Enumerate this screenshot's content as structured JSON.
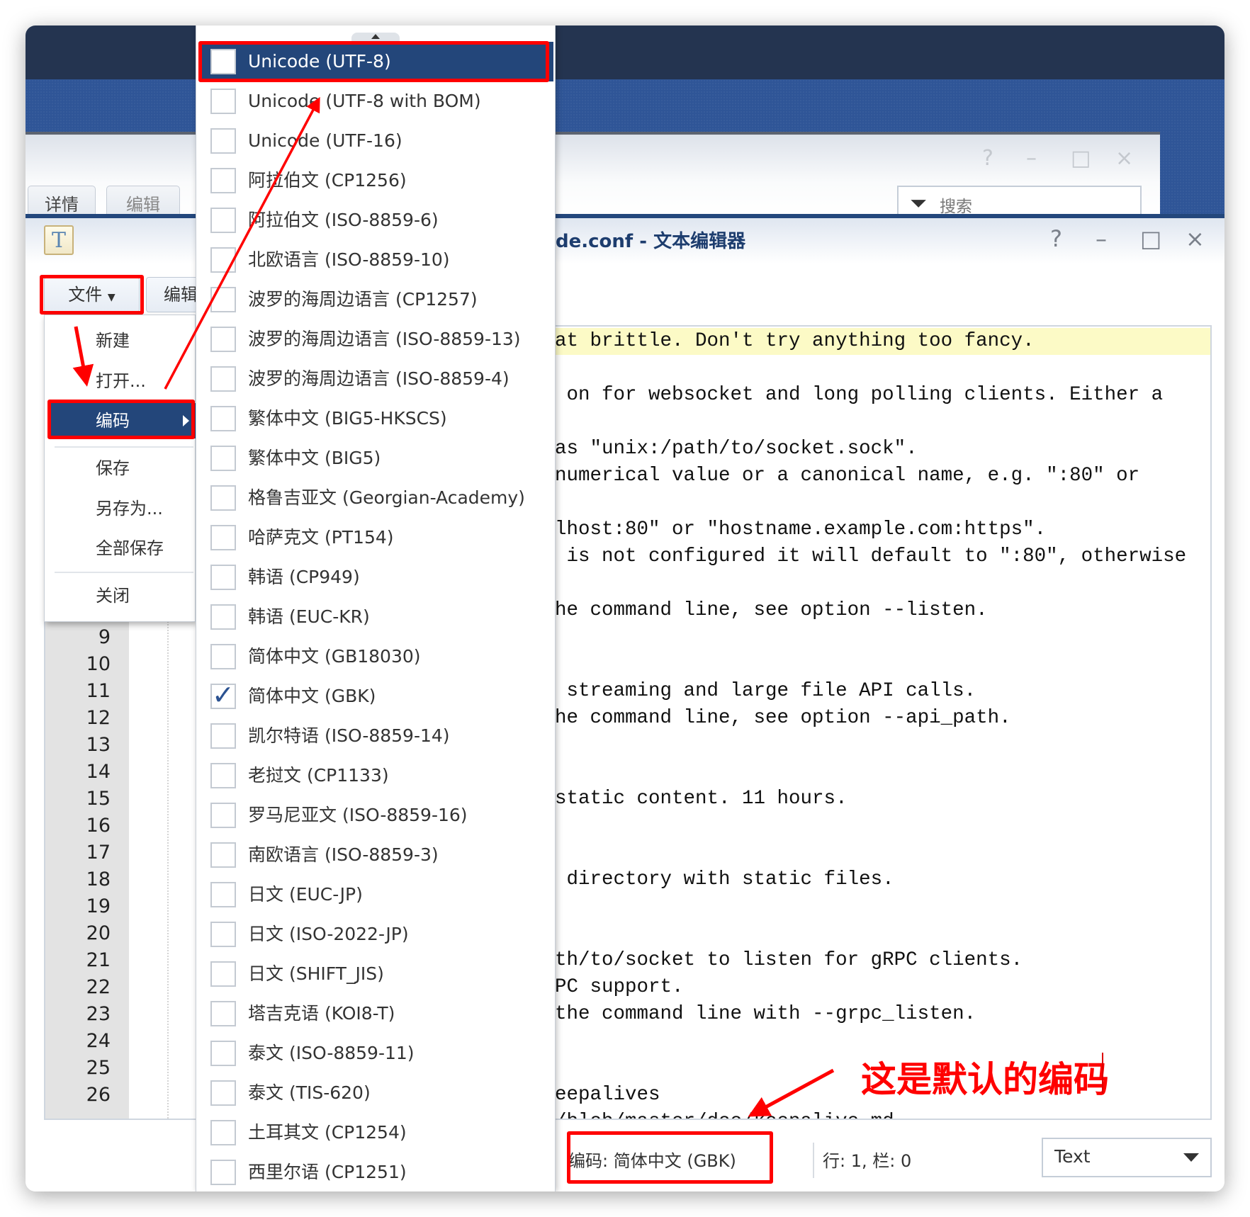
{
  "back_window": {
    "tabs": [
      "详情",
      "编辑"
    ],
    "controls": [
      "?",
      "–",
      "□",
      "×"
    ],
    "search_placeholder": "搜索"
  },
  "editor_window": {
    "title": "de.conf - 文本编辑器",
    "controls": [
      "?",
      "–",
      "□",
      "×"
    ],
    "toolbar": {
      "file_label": "文件",
      "edit_label": "编辑"
    },
    "line_numbers": [
      "9",
      "10",
      "11",
      "12",
      "13",
      "14",
      "15",
      "16",
      "17",
      "18",
      "19",
      "20",
      "21",
      "22",
      "23",
      "24",
      "25",
      "26"
    ],
    "text_rows": [
      {
        "row": 0,
        "text": "at brittle. Don't try anything too fancy.",
        "highlight": true
      },
      {
        "row": 2,
        "text": " on for websocket and long polling clients. Either a"
      },
      {
        "row": 4,
        "text": "as \"unix:/path/to/socket.sock\"."
      },
      {
        "row": 5,
        "text": "numerical value or a canonical name, e.g. \":80\" or"
      },
      {
        "row": 7,
        "text": "lhost:80\" or \"hostname.example.com:https\"."
      },
      {
        "row": 8,
        "text": " is not configured it will default to \":80\", otherwise"
      },
      {
        "row": 10,
        "text": "he command line, see option --listen."
      },
      {
        "row": 13,
        "text": " streaming and large file API calls."
      },
      {
        "row": 14,
        "text": "he command line, see option --api_path."
      },
      {
        "row": 17,
        "text": "static content. 11 hours."
      },
      {
        "row": 20,
        "text": " directory with static files."
      },
      {
        "row": 23,
        "text": "th/to/socket to listen for gRPC clients."
      },
      {
        "row": 24,
        "text": "PC support."
      },
      {
        "row": 25,
        "text": "the command line with --grpc_listen."
      },
      {
        "row": 28,
        "text": "eepalives"
      },
      {
        "row": 29,
        "text": "/blob/master/doc/keepalive.md"
      }
    ],
    "status": {
      "encoding": "编码: 简体中文 (GBK)",
      "position": "行: 1, 栏: 0",
      "mode": "Text"
    }
  },
  "file_menu": {
    "items": [
      "新建",
      "打开...",
      "编码",
      "保存",
      "另存为...",
      "全部保存",
      "关闭"
    ],
    "selected": "编码"
  },
  "encoding_menu": {
    "items": [
      "Unicode (UTF-8)",
      "Unicode (UTF-8 with BOM)",
      "Unicode (UTF-16)",
      "阿拉伯文 (CP1256)",
      "阿拉伯文 (ISO-8859-6)",
      "北欧语言 (ISO-8859-10)",
      "波罗的海周边语言 (CP1257)",
      "波罗的海周边语言 (ISO-8859-13)",
      "波罗的海周边语言 (ISO-8859-4)",
      "繁体中文 (BIG5-HKSCS)",
      "繁体中文 (BIG5)",
      "格鲁吉亚文 (Georgian-Academy)",
      "哈萨克文 (PT154)",
      "韩语 (CP949)",
      "韩语 (EUC-KR)",
      "简体中文 (GB18030)",
      "简体中文 (GBK)",
      "凯尔特语 (ISO-8859-14)",
      "老挝文 (CP1133)",
      "罗马尼亚文 (ISO-8859-16)",
      "南欧语言 (ISO-8859-3)",
      "日文 (EUC-JP)",
      "日文 (ISO-2022-JP)",
      "日文 (SHIFT_JIS)",
      "塔吉克语 (KOI8-T)",
      "泰文 (ISO-8859-11)",
      "泰文 (TIS-620)",
      "土耳其文 (CP1254)",
      "西里尔语 (CP1251)"
    ],
    "highlighted": "Unicode (UTF-8)",
    "checked": "简体中文 (GBK)"
  },
  "annotation": {
    "text": "这是默认的编码",
    "color": "#ff0000"
  },
  "colors": {
    "menu_highlight": "#23467a",
    "desktop_blue": "#2f5597",
    "current_line": "#fcfac6"
  }
}
